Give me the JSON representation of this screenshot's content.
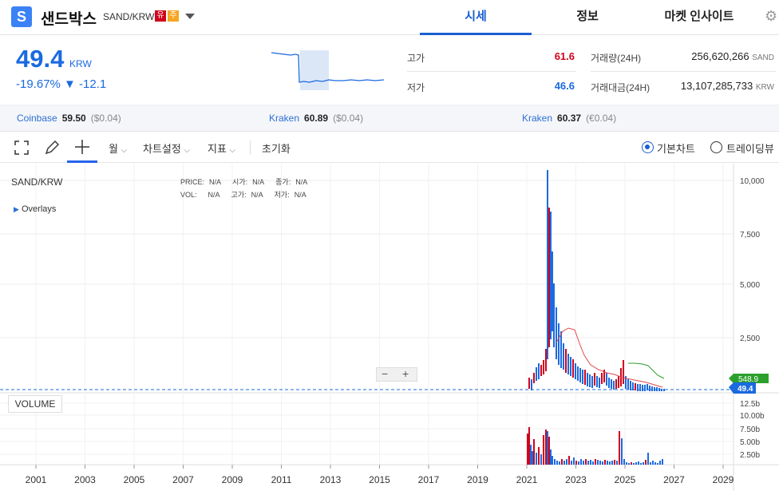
{
  "header": {
    "logo_letter": "S",
    "coin_name": "샌드박스",
    "pair": "SAND/KRW",
    "badge_1": "유",
    "badge_2": "주",
    "tabs": [
      {
        "label": "시세",
        "active": true
      },
      {
        "label": "정보",
        "active": false
      },
      {
        "label": "마켓 인사이트",
        "active": false
      }
    ]
  },
  "quote": {
    "price": "49.4",
    "currency": "KRW",
    "change_pct": "-19.67%",
    "change_abs": "▼ -12.1",
    "high_label": "고가",
    "high_value": "61.6",
    "low_label": "저가",
    "low_value": "46.6",
    "volume_label": "거래량(24H)",
    "volume_value": "256,620,266",
    "volume_unit": "SAND",
    "amount_label": "거래대금(24H)",
    "amount_value": "13,107,285,733",
    "amount_unit": "KRW"
  },
  "exchanges": [
    {
      "name": "Coinbase",
      "price": "59.50",
      "diff": "($0.04)"
    },
    {
      "name": "Kraken",
      "price": "60.89",
      "diff": "($0.04)"
    },
    {
      "name": "Kraken",
      "price": "60.37",
      "diff": "(€0.04)"
    }
  ],
  "toolbar": {
    "interval": "월",
    "chart_settings": "차트설정",
    "indicators": "지표",
    "reset": "초기화",
    "basic_chart": "기본차트",
    "trading_view": "트레이딩뷰"
  },
  "chart": {
    "symbol": "SAND/KRW",
    "overlays_label": "Overlays",
    "info_row1": [
      {
        "label": "PRICE:",
        "value": "N/A"
      },
      {
        "label": "시가:",
        "value": "N/A"
      },
      {
        "label": "종가:",
        "value": "N/A"
      }
    ],
    "info_row2": [
      {
        "label": "VOL:",
        "value": "N/A"
      },
      {
        "label": "고가:",
        "value": "N/A"
      },
      {
        "label": "저가:",
        "value": "N/A"
      }
    ],
    "volume_label": "VOLUME",
    "zoom_minus": "−",
    "zoom_plus": "+",
    "price_ticks": [
      "10,000",
      "7,500",
      "5,000",
      "2,500"
    ],
    "volume_ticks": [
      "12.5b",
      "10.00b",
      "7.50b",
      "5.00b",
      "2.50b"
    ],
    "years": [
      "2001",
      "2003",
      "2005",
      "2007",
      "2009",
      "2011",
      "2013",
      "2015",
      "2017",
      "2019",
      "2021",
      "2023",
      "2025",
      "2027",
      "2029"
    ],
    "last_price_tag": "49.4",
    "ma_tag": "548.9",
    "colors": {
      "up": "#d0021b",
      "down": "#1b6ae0",
      "ma_short": "#e0474c",
      "ma_long": "#2ca02c"
    }
  }
}
